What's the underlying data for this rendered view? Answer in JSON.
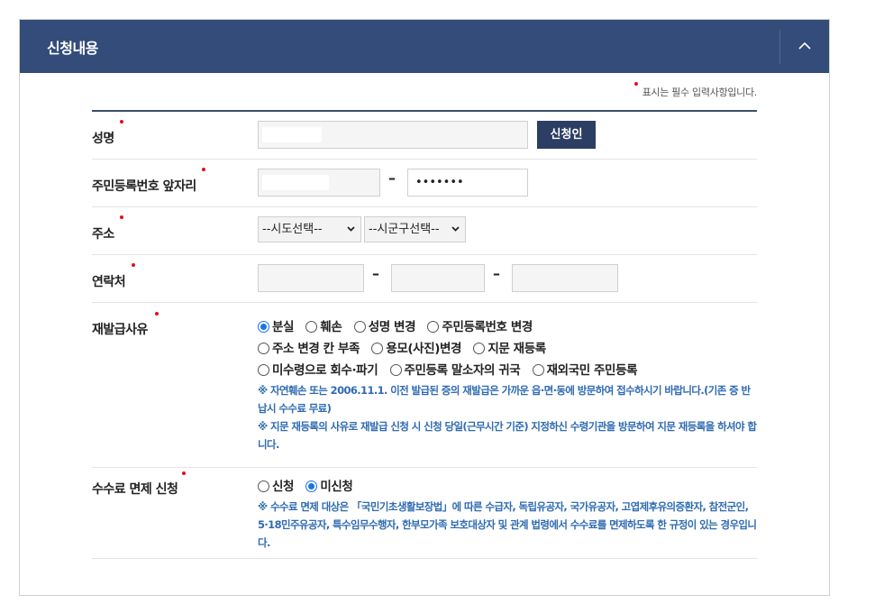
{
  "header": {
    "title": "신청내용"
  },
  "required_note": "표시는 필수 입력사항입니다.",
  "fields": {
    "name": {
      "label": "성명",
      "button": "신청인"
    },
    "resident": {
      "label": "주민등록번호 앞자리",
      "separator": "–",
      "second_value": "•••••••"
    },
    "address": {
      "label": "주소",
      "sido_selected": "--시도선택--",
      "sigungu_selected": "--시군구선택--"
    },
    "contact": {
      "label": "연락처",
      "separator": "–"
    },
    "reason": {
      "label": "재발급사유",
      "options_line1": [
        "분실",
        "훼손",
        "성명 변경",
        "주민등록번호 변경"
      ],
      "options_line2": [
        "주소 변경 칸 부족",
        "용모(사진)변경",
        "지문 재등록"
      ],
      "options_line3": [
        "미수령으로 회수·파기",
        "주민등록 말소자의 귀국",
        "재외국민 주민등록"
      ],
      "selected": "분실",
      "note1": "※ 자연훼손 또는 2006.11.1. 이전 발급된 증의 재발급은 가까운 읍·면·동에 방문하여 접수하시기 바랍니다.(기존 증 반납시 수수료 무료)",
      "note2": "※ 지문 재등록의 사유로 재발급 신청 시 신청 당일(근무시간 기준) 지정하신 수령기관을 방문하여 지문 재등록을 하셔야 합니다."
    },
    "fee": {
      "label": "수수료 면제 신청",
      "options": [
        "신청",
        "미신청"
      ],
      "selected": "미신청",
      "note": "※ 수수료 면제 대상은 「국민기초생활보장법」에 따른 수급자, 독립유공자, 국가유공자, 고엽제후유의증환자, 참전군인, 5·18민주유공자, 특수임무수행자, 한부모가족 보호대상자 및 관계 법령에서 수수료를 면제하도록 한 규정이 있는 경우입니다."
    }
  }
}
